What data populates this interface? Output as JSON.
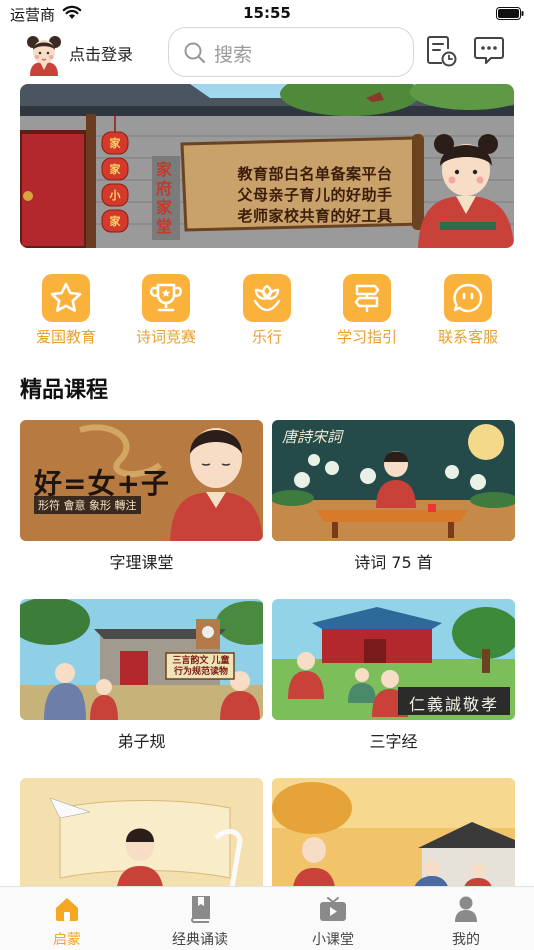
{
  "status": {
    "carrier": "运营商",
    "time": "15:55"
  },
  "header": {
    "login_label": "点击登录",
    "search_placeholder": "搜索"
  },
  "banner": {
    "lines": [
      "教育部白名单备案平台",
      "父母亲子育儿的好助手",
      "老师家校共育的好工具"
    ],
    "lanterns": [
      "家",
      "家",
      "小",
      "家",
      "家"
    ],
    "sign": "家府家堂"
  },
  "categories": [
    {
      "label": "爱国教育",
      "icon": "star-icon"
    },
    {
      "label": "诗词竞赛",
      "icon": "trophy-icon"
    },
    {
      "label": "乐行",
      "icon": "flower-icon"
    },
    {
      "label": "学习指引",
      "icon": "signpost-icon"
    },
    {
      "label": "联系客服",
      "icon": "chat-smile-icon"
    }
  ],
  "section_title": "精品课程",
  "courses": [
    {
      "title": "字理课堂",
      "thumb_text": "好=女+子",
      "thumb_sub": "形符 會意 象形 轉注"
    },
    {
      "title": "诗词 75 首",
      "thumb_text": "唐詩宋詞"
    },
    {
      "title": "弟子规",
      "thumb_text": "三言韵文 儿童行为规范读物"
    },
    {
      "title": "三字经",
      "thumb_text": "仁義誠敬孝"
    },
    {
      "title": "",
      "thumb_text": ""
    },
    {
      "title": "",
      "thumb_text": ""
    }
  ],
  "tabs": [
    {
      "label": "启蒙",
      "icon": "home-icon",
      "active": true
    },
    {
      "label": "经典诵读",
      "icon": "book-icon",
      "active": false
    },
    {
      "label": "小课堂",
      "icon": "tv-icon",
      "active": false
    },
    {
      "label": "我的",
      "icon": "person-icon",
      "active": false
    }
  ],
  "colors": {
    "accent": "#fbb23c",
    "accent_text": "#e7a12f",
    "tab_active": "#f5a623",
    "tab_inactive": "#8a8a8a"
  }
}
